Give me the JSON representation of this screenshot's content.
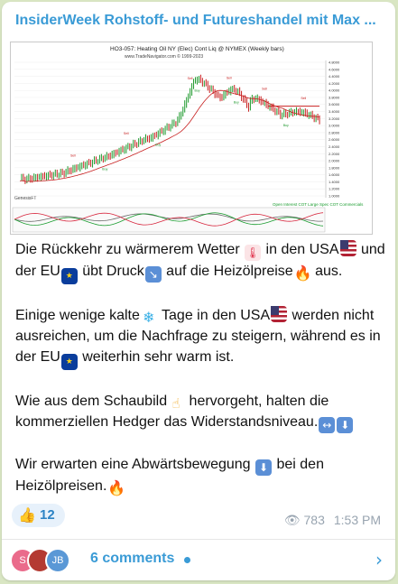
{
  "channel": {
    "title": "InsiderWeek Rohstoff- und Futureshandel mit Max ..."
  },
  "chart": {
    "header": "HO3-057:  Heating Oil NY (Elec) Cont Liq @ NYMEX  (Weekly bars)",
    "subheader": "www.TradeNavigator.com © 1999-2023",
    "corner_label": "GenesisFT",
    "legend": "Open Interest  COT Large Spec  COT Commercials",
    "price_labels": [
      "4.8000",
      "4.6000",
      "4.4000",
      "4.2000",
      "4.0000",
      "3.8000",
      "3.6000",
      "3.4000",
      "3.2000",
      "3.0000",
      "2.8000",
      "2.6000",
      "2.4000",
      "2.2000",
      "2.0000",
      "1.8000",
      "1.6000",
      "1.4000",
      "1.2000",
      "1.0000"
    ],
    "signal_labels": [
      "Sell",
      "Buy"
    ],
    "colors": {
      "up_bar": "#1f9a2e",
      "down_bar": "#c71f1f",
      "moving_average": "#c71f1f",
      "resistance": "#c71f1f",
      "large_spec": "#1a9c2f",
      "commercials": "#d7263d",
      "open_interest": "#6a6a6a"
    }
  },
  "message": {
    "paragraphs": [
      [
        {
          "t": "Die Rückkehr zu wärmerem Wetter "
        },
        {
          "e": "thermo",
          "g": "🌡"
        },
        {
          "t": " in den USA"
        },
        {
          "e": "flag-us",
          "g": ""
        },
        {
          "t": " und der EU"
        },
        {
          "e": "flag-eu",
          "g": "★"
        },
        {
          "t": " übt Druck"
        },
        {
          "e": "arrow",
          "g": "↘"
        },
        {
          "t": " auf die Heizölpreise"
        },
        {
          "e": "fire",
          "g": "🔥"
        },
        {
          "t": " aus."
        }
      ],
      [
        {
          "t": "Einige wenige kalte"
        },
        {
          "e": "cold",
          "g": "❄"
        },
        {
          "t": " Tage in den USA"
        },
        {
          "e": "flag-us",
          "g": ""
        },
        {
          "t": " werden nicht ausreichen, um die Nachfrage zu steigern, während es in der EU"
        },
        {
          "e": "flag-eu",
          "g": "★"
        },
        {
          "t": " weiterhin sehr warm ist."
        }
      ],
      [
        {
          "t": "Wie aus dem Schaubild"
        },
        {
          "e": "hand",
          "g": "☝"
        },
        {
          "t": " hervorgeht, halten die kommerziellen Hedger das Widerstandsniveau."
        },
        {
          "e": "arrow",
          "g": "↔"
        },
        {
          "e": "arrow",
          "g": "⬇"
        }
      ],
      [
        {
          "t": "Wir erwarten eine Abwärtsbewegung "
        },
        {
          "e": "arrow",
          "g": "⬇"
        },
        {
          "t": " bei den Heizölpreisen."
        },
        {
          "e": "fire",
          "g": "🔥"
        }
      ]
    ]
  },
  "reaction": {
    "icon": "thumbs-up-icon",
    "glyph": "👍",
    "count": "12"
  },
  "meta": {
    "views_icon": "eye-icon",
    "views": "783",
    "time": "1:53 PM"
  },
  "comments": {
    "avatars": [
      "S",
      "",
      "JB"
    ],
    "label": "6 comments"
  }
}
